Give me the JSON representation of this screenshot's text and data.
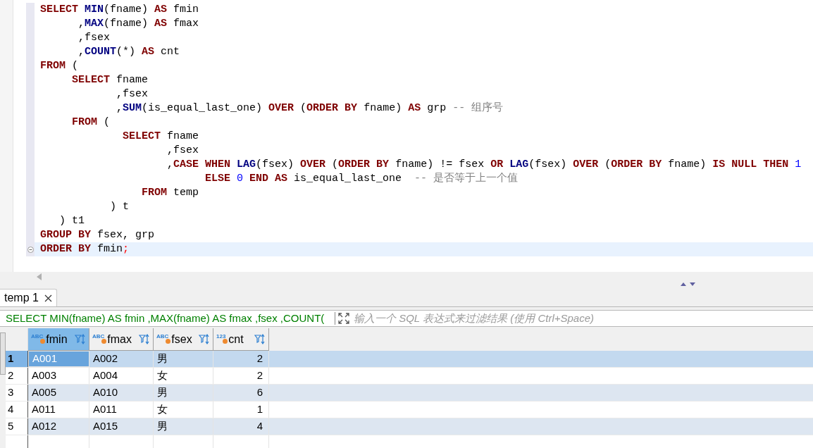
{
  "editor": {
    "lines": [
      {
        "current": false,
        "fold_marker": false,
        "tokens": [
          {
            "kind": "k",
            "text": "SELECT "
          },
          {
            "kind": "f",
            "text": "MIN"
          },
          {
            "kind": "t",
            "text": "(fname) "
          },
          {
            "kind": "k",
            "text": "AS"
          },
          {
            "kind": "t",
            "text": " fmin"
          }
        ]
      },
      {
        "current": false,
        "fold_marker": false,
        "tokens": [
          {
            "kind": "t",
            "text": "      ,"
          },
          {
            "kind": "f",
            "text": "MAX"
          },
          {
            "kind": "t",
            "text": "(fname) "
          },
          {
            "kind": "k",
            "text": "AS"
          },
          {
            "kind": "t",
            "text": " fmax"
          }
        ]
      },
      {
        "current": false,
        "fold_marker": false,
        "tokens": [
          {
            "kind": "t",
            "text": "      ,fsex"
          }
        ]
      },
      {
        "current": false,
        "fold_marker": false,
        "tokens": [
          {
            "kind": "t",
            "text": "      ,"
          },
          {
            "kind": "f",
            "text": "COUNT"
          },
          {
            "kind": "t",
            "text": "(*) "
          },
          {
            "kind": "k",
            "text": "AS"
          },
          {
            "kind": "t",
            "text": " cnt"
          }
        ]
      },
      {
        "current": false,
        "fold_marker": false,
        "tokens": [
          {
            "kind": "k",
            "text": "FROM"
          },
          {
            "kind": "t",
            "text": " ("
          }
        ]
      },
      {
        "current": false,
        "fold_marker": false,
        "tokens": [
          {
            "kind": "k",
            "text": "     SELECT"
          },
          {
            "kind": "t",
            "text": " fname"
          }
        ]
      },
      {
        "current": false,
        "fold_marker": false,
        "tokens": [
          {
            "kind": "t",
            "text": "            ,fsex"
          }
        ]
      },
      {
        "current": false,
        "fold_marker": false,
        "tokens": [
          {
            "kind": "t",
            "text": "            ,"
          },
          {
            "kind": "f",
            "text": "SUM"
          },
          {
            "kind": "t",
            "text": "(is_equal_last_one) "
          },
          {
            "kind": "k",
            "text": "OVER"
          },
          {
            "kind": "t",
            "text": " ("
          },
          {
            "kind": "k",
            "text": "ORDER BY"
          },
          {
            "kind": "t",
            "text": " fname) "
          },
          {
            "kind": "k",
            "text": "AS"
          },
          {
            "kind": "t",
            "text": " grp "
          },
          {
            "kind": "c",
            "text": "-- 组序号"
          }
        ]
      },
      {
        "current": false,
        "fold_marker": false,
        "tokens": [
          {
            "kind": "k",
            "text": "     FROM"
          },
          {
            "kind": "t",
            "text": " ("
          }
        ]
      },
      {
        "current": false,
        "fold_marker": false,
        "tokens": [
          {
            "kind": "k",
            "text": "             SELECT"
          },
          {
            "kind": "t",
            "text": " fname"
          }
        ]
      },
      {
        "current": false,
        "fold_marker": false,
        "tokens": [
          {
            "kind": "t",
            "text": "                    ,fsex"
          }
        ]
      },
      {
        "current": false,
        "fold_marker": false,
        "tokens": [
          {
            "kind": "t",
            "text": "                    ,"
          },
          {
            "kind": "k",
            "text": "CASE WHEN "
          },
          {
            "kind": "f",
            "text": "LAG"
          },
          {
            "kind": "t",
            "text": "(fsex) "
          },
          {
            "kind": "k",
            "text": "OVER"
          },
          {
            "kind": "t",
            "text": " ("
          },
          {
            "kind": "k",
            "text": "ORDER BY"
          },
          {
            "kind": "t",
            "text": " fname) != fsex "
          },
          {
            "kind": "k",
            "text": "OR "
          },
          {
            "kind": "f",
            "text": "LAG"
          },
          {
            "kind": "t",
            "text": "(fsex) "
          },
          {
            "kind": "k",
            "text": "OVER"
          },
          {
            "kind": "t",
            "text": " ("
          },
          {
            "kind": "k",
            "text": "ORDER BY"
          },
          {
            "kind": "t",
            "text": " fname) "
          },
          {
            "kind": "k",
            "text": "IS NULL THEN "
          },
          {
            "kind": "n",
            "text": "1"
          }
        ]
      },
      {
        "current": false,
        "fold_marker": false,
        "tokens": [
          {
            "kind": "k",
            "text": "                          ELSE "
          },
          {
            "kind": "n",
            "text": "0"
          },
          {
            "kind": "k",
            "text": " END AS"
          },
          {
            "kind": "t",
            "text": " is_equal_last_one  "
          },
          {
            "kind": "c",
            "text": "-- 是否等于上一个值"
          }
        ]
      },
      {
        "current": false,
        "fold_marker": false,
        "tokens": [
          {
            "kind": "k",
            "text": "                FROM"
          },
          {
            "kind": "t",
            "text": " temp"
          }
        ]
      },
      {
        "current": false,
        "fold_marker": false,
        "tokens": [
          {
            "kind": "t",
            "text": "           ) t"
          }
        ]
      },
      {
        "current": false,
        "fold_marker": false,
        "tokens": [
          {
            "kind": "t",
            "text": "   ) t1"
          }
        ]
      },
      {
        "current": false,
        "fold_marker": false,
        "tokens": [
          {
            "kind": "k",
            "text": "GROUP BY"
          },
          {
            "kind": "t",
            "text": " fsex, grp"
          }
        ]
      },
      {
        "current": true,
        "fold_marker": true,
        "tokens": [
          {
            "kind": "k",
            "text": "ORDER BY"
          },
          {
            "kind": "t",
            "text": " fmin"
          },
          {
            "kind": "p",
            "text": ";"
          }
        ]
      }
    ]
  },
  "results": {
    "tabs": [
      {
        "label": "temp 1",
        "selected": true
      }
    ],
    "query_text": "SELECT MIN(fname) AS fmin ,MAX(fname) AS fmax ,fsex ,COUNT(",
    "filter": {
      "placeholder": "输入一个 SQL 表达式来过滤结果 (使用 Ctrl+Space)"
    },
    "table": {
      "columns": [
        {
          "name": "fmin",
          "type_label": "ABC",
          "numeric": false,
          "selected": true
        },
        {
          "name": "fmax",
          "type_label": "ABC",
          "numeric": false,
          "selected": false
        },
        {
          "name": "fsex",
          "type_label": "ABC",
          "numeric": false,
          "selected": false
        },
        {
          "name": "cnt",
          "type_label": "123",
          "numeric": true,
          "selected": false
        }
      ],
      "rows": [
        {
          "number": "1",
          "selected": true,
          "cells": [
            "A001",
            "A002",
            "男",
            "2"
          ]
        },
        {
          "number": "2",
          "selected": false,
          "cells": [
            "A003",
            "A004",
            "女",
            "2"
          ]
        },
        {
          "number": "3",
          "selected": false,
          "cells": [
            "A005",
            "A010",
            "男",
            "6"
          ]
        },
        {
          "number": "4",
          "selected": false,
          "cells": [
            "A011",
            "A011",
            "女",
            "1"
          ]
        },
        {
          "number": "5",
          "selected": false,
          "cells": [
            "A012",
            "A015",
            "男",
            "4"
          ]
        }
      ]
    }
  }
}
